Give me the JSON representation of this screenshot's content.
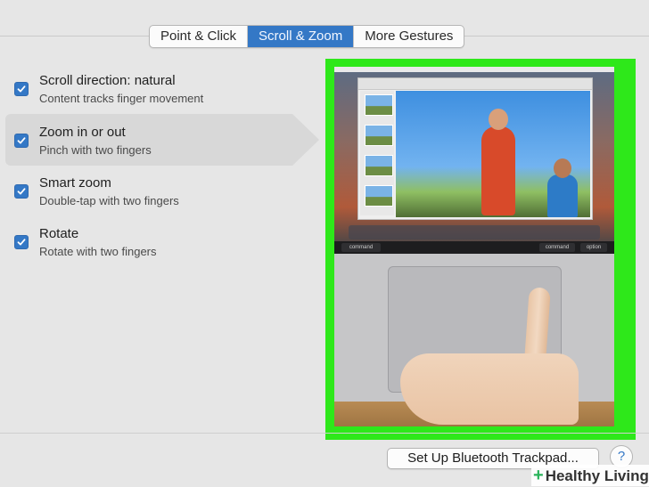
{
  "tabs": [
    {
      "label": "Point & Click",
      "active": false
    },
    {
      "label": "Scroll & Zoom",
      "active": true
    },
    {
      "label": "More Gestures",
      "active": false
    }
  ],
  "options": [
    {
      "title": "Scroll direction: natural",
      "subtitle": "Content tracks finger movement",
      "checked": true,
      "selected": false
    },
    {
      "title": "Zoom in or out",
      "subtitle": "Pinch with two fingers",
      "checked": true,
      "selected": true
    },
    {
      "title": "Smart zoom",
      "subtitle": "Double-tap with two fingers",
      "checked": true,
      "selected": false
    },
    {
      "title": "Rotate",
      "subtitle": "Rotate with two fingers",
      "checked": true,
      "selected": false
    }
  ],
  "preview": {
    "keys": {
      "command_left": "command",
      "command_right": "command",
      "option_right": "option"
    },
    "highlight_color": "#2ee81a"
  },
  "buttons": {
    "setup_bluetooth": "Set Up Bluetooth Trackpad...",
    "help": "?"
  },
  "watermark": {
    "symbol": "+",
    "text": "Healthy Living"
  },
  "colors": {
    "accent": "#3478c6",
    "background": "#e6e6e6"
  }
}
